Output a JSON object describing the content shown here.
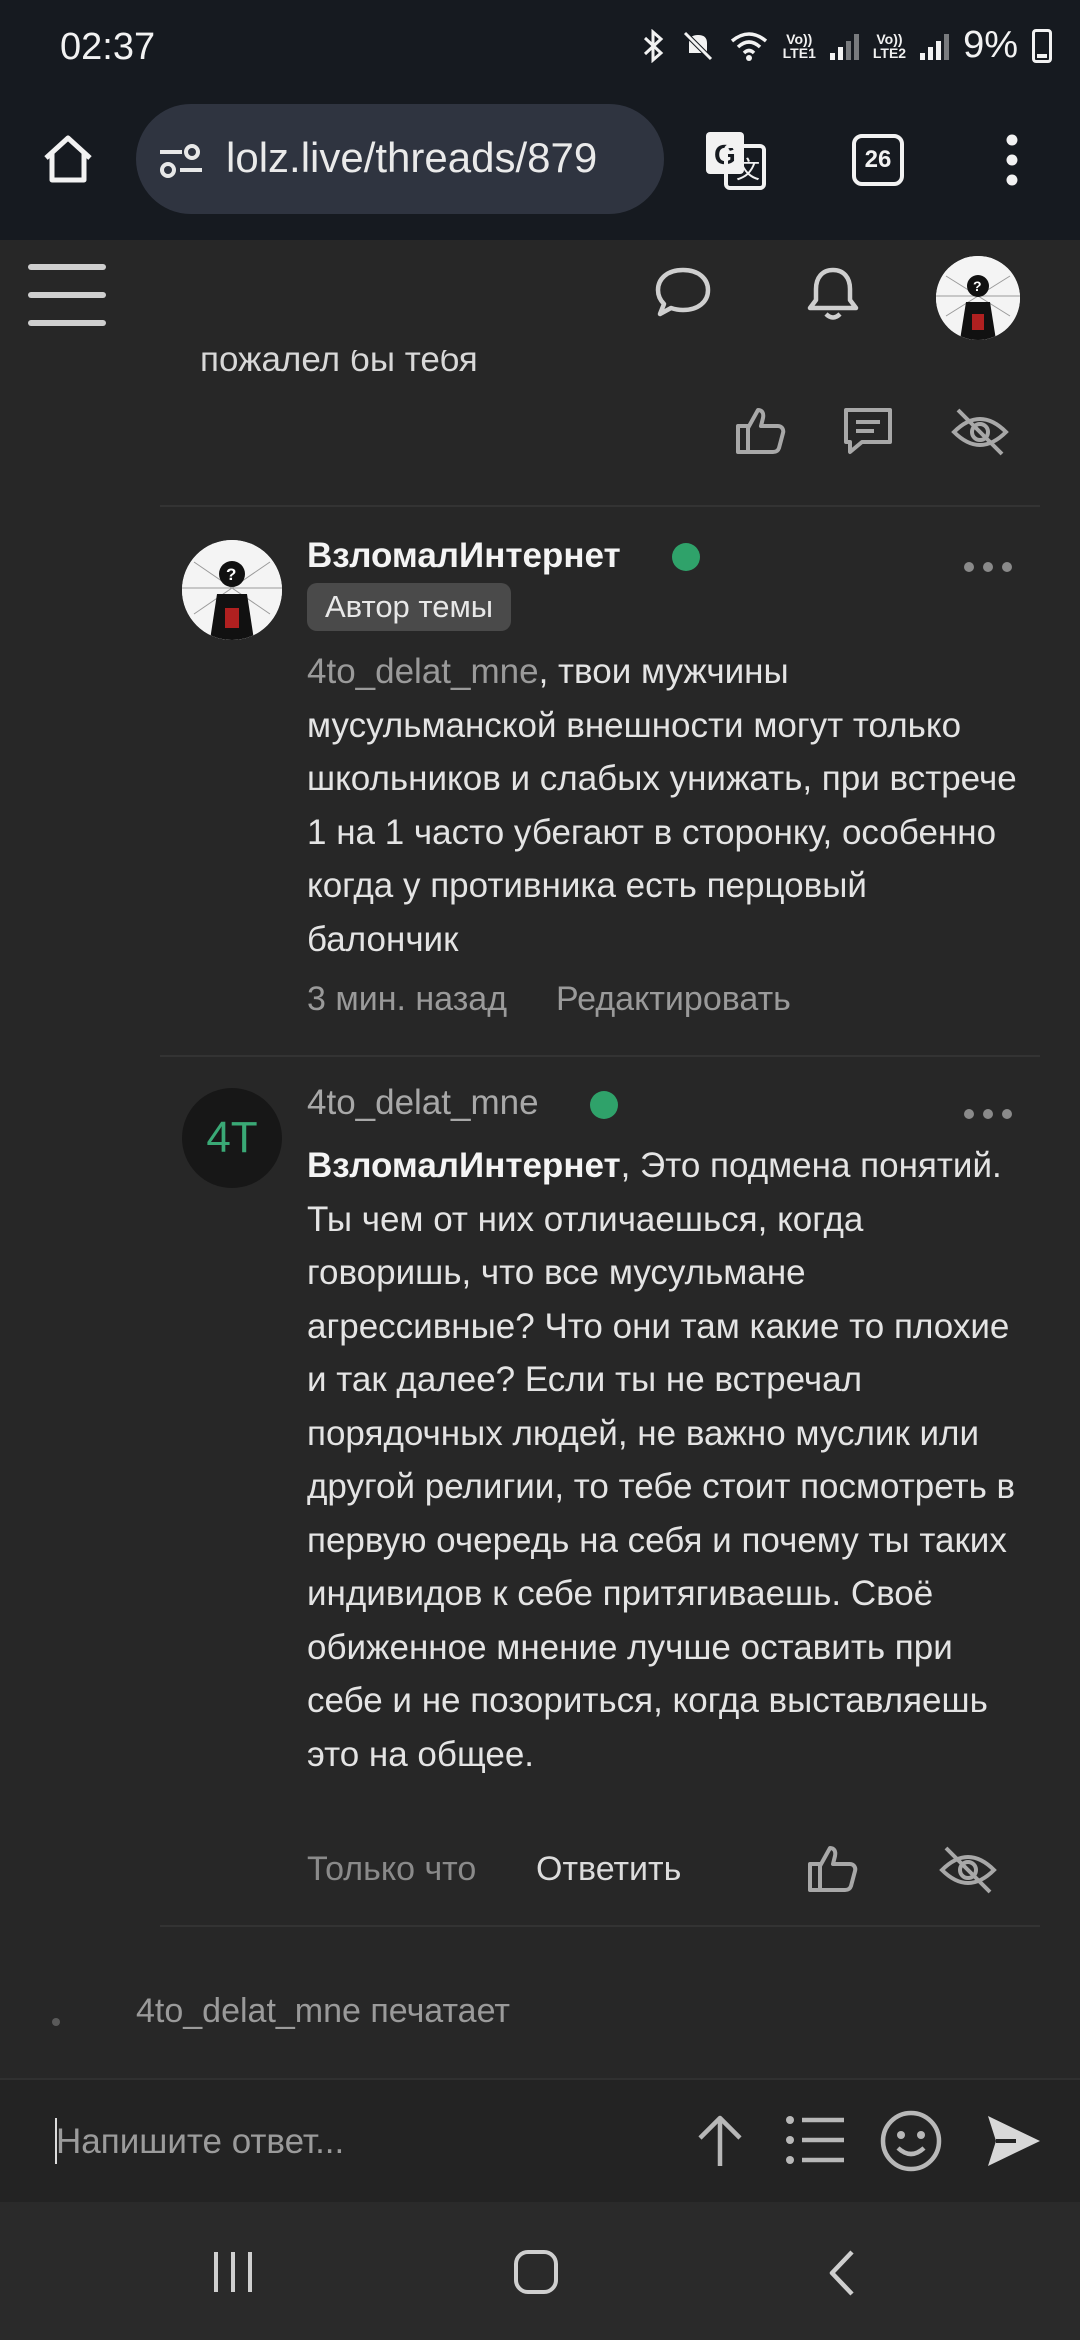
{
  "status_bar": {
    "time": "02:37",
    "battery": "9%",
    "sim1": "LTE1",
    "sim2": "LTE2",
    "volte": "Vo))"
  },
  "browser": {
    "url": "lolz.live/threads/879",
    "tab_count": "26"
  },
  "previous_post": {
    "text_tail": "пожалел бы тебя"
  },
  "posts": [
    {
      "author": "ВзломалИнтернет",
      "badge": "Автор темы",
      "mention": "4to_delat_mne",
      "text": ", твои мужчины мусульманской внешности могут только школьников и слабых унижать, при встрече 1 на 1 часто убегают в сторонку, особенно когда у противника есть перцовый балончик",
      "time": "3 мин. назад",
      "action": "Редактировать"
    },
    {
      "author": "4to_delat_mne",
      "avatar_initials": "4T",
      "mention": "ВзломалИнтернет",
      "text": ", Это подмена понятий. Ты чем от них отличаешься, когда говоришь, что все мусульмане агрессивные? Что они там какие то плохие и так далее? Если ты не встречал порядочных людей, не важно муслик или другой религии, то тебе стоит посмотреть в первую очередь на себя и почему ты таких индивидов к себе притягиваешь. Своё обиженное мнение лучше оставить при себе и не позориться, когда выставляешь это на общее.",
      "time": "Только что",
      "action": "Ответить"
    }
  ],
  "typing_indicator": "4to_delat_mne печатает",
  "composer": {
    "placeholder": "Напишите ответ..."
  },
  "colors": {
    "background": "#272727",
    "chrome": "#161a20",
    "online": "#2fa26a",
    "avatar_text": "#3aa976"
  }
}
